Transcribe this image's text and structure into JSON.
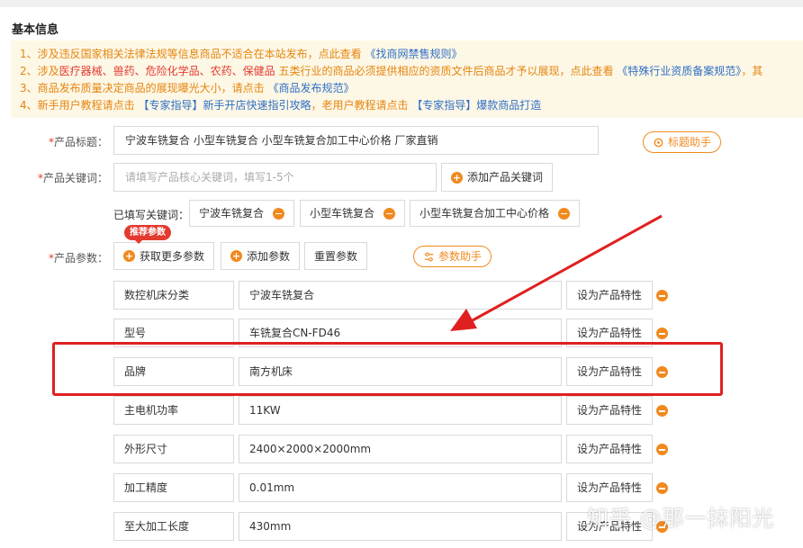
{
  "section_title": "基本信息",
  "notice": {
    "line1_prefix": "1、涉及违反国家相关法律法规等信息商品不适合在本站发布，点此查看",
    "line1_link": "《找商网禁售规则》",
    "line2_prefix": "2、涉及",
    "line2_categories": "医疗器械、兽药、危险化学品、农药、保健品",
    "line2_middle": " 五类行业的商品必须提供相应的资质文件后商品才予以展现，点此查看 ",
    "line2_link": "《特殊行业资质备案规范》",
    "line2_suffix": "，其",
    "line3_prefix": "3、商品发布质量决定商品的展现曝光大小，请点击 ",
    "line3_link": "《商品发布规范》",
    "line4_prefix": "4、新手用户教程请点击 ",
    "line4_link1": "【专家指导】新手开店快速指引攻略",
    "line4_middle": "，老用户教程请点击 ",
    "line4_link2": "【专家指导】爆款商品打造"
  },
  "product_title": {
    "label_star": "*",
    "label": "产品标题：",
    "value": "宁波车铣复合 小型车铣复合 小型车铣复合加工中心价格 厂家直销",
    "assistant_button": "标题助手"
  },
  "product_keywords": {
    "label_star": "*",
    "label": "产品关键词：",
    "placeholder": "请填写产品核心关键词，填写1-5个",
    "add_button": "添加产品关键词",
    "filled_label": "已填写关键词：",
    "tags": [
      "宁波车铣复合",
      "小型车铣复合",
      "小型车铣复合加工中心价格"
    ]
  },
  "product_params": {
    "label_star": "*",
    "label": "产品参数：",
    "badge": "推荐参数",
    "get_more_button": "获取更多参数",
    "add_button": "添加参数",
    "reset_button": "重置参数",
    "assistant_button": "参数助手",
    "set_feature_label": "设为产品特性",
    "rows": [
      {
        "name": "数控机床分类",
        "value": "宁波车铣复合"
      },
      {
        "name": "型号",
        "value": "车铣复合CN-FD46"
      },
      {
        "name": "品牌",
        "value": "南方机床"
      },
      {
        "name": "主电机功率",
        "value": "11KW"
      },
      {
        "name": "外形尺寸",
        "value": "2400×2000×2000mm"
      },
      {
        "name": "加工精度",
        "value": "0.01mm"
      },
      {
        "name": "至大加工长度",
        "value": "430mm"
      }
    ]
  },
  "colors": {
    "accent_orange": "#f08a1f",
    "highlight_red": "#e02020",
    "link_blue": "#2f6fc4",
    "notice_bg": "#fdf7e6"
  },
  "watermark": "知乎 @那一抹阳光"
}
